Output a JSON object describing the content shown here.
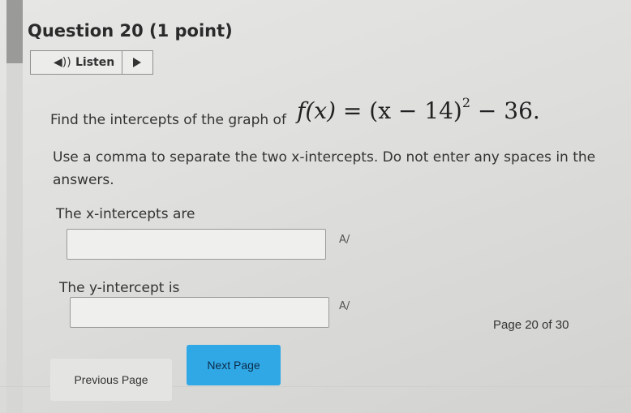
{
  "question": {
    "title": "Question 20 (1 point)",
    "listen_label": "Listen",
    "prompt_prefix": "Find the intercepts of the graph of",
    "formula": {
      "lhs": "f(x)",
      "eq": "=",
      "base": "(x − 14)",
      "exponent": "2",
      "tail": "− 36."
    },
    "instruction_line1": "Use a comma to separate the two x-intercepts. Do not enter any spaces in the",
    "instruction_line2": "answers.",
    "x_label": "The x-intercepts are",
    "x_value": "",
    "y_label": "The y-intercept is",
    "y_value": ""
  },
  "icons": {
    "speaker": "speaker-icon",
    "play": "play-icon",
    "spellcheck": "spellcheck-icon"
  },
  "spell_glyph": "A/",
  "speaker_glyph": "◀))",
  "nav": {
    "previous_label": "Previous Page",
    "next_label": "Next Page",
    "page_indicator": "Page 20 of 30"
  },
  "colors": {
    "next_button": "#30a8e6",
    "background": "#dededc"
  }
}
